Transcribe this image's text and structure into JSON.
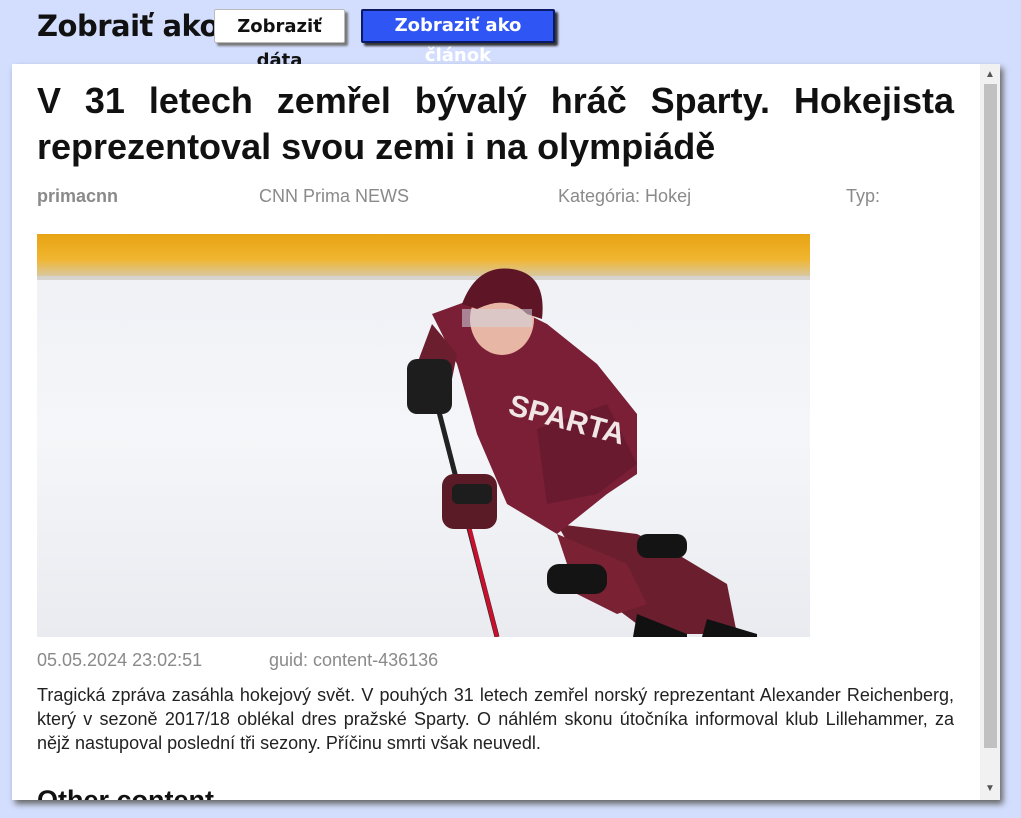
{
  "toolbar": {
    "view_as_label": "Zobraiť ako:",
    "view_data_label": "Zobraziť dáta",
    "view_article_label": "Zobraziť ako článok"
  },
  "article": {
    "title": "V 31 letech zemřel bývalý hráč Sparty. Hokejista reprezentoval svou zemi i na olympiádě",
    "author": "primacnn",
    "source": "CNN Prima NEWS",
    "category": "Kategória: Hokej",
    "type": "Typ:",
    "date": "05.05.2024 23:02:51",
    "guid": "guid: content-436136",
    "body": "Tragická zpráva zasáhla hokejový svět. V pouhých 31 letech zemřel norský reprezentant Alexander Reichenberg, který v sezoně 2017/18 oblékal dres pražské Sparty. O náhlém skonu útočníka informoval klub Lillehammer, za nějž nastupoval poslední tři sezony. Příčinu smrti však neuvedl.",
    "image_alt": "hockey-player-photo",
    "jersey_text": "SPARTA"
  },
  "other": {
    "heading": "Other content"
  },
  "scroll": {
    "up": "▲",
    "down": "▼"
  }
}
